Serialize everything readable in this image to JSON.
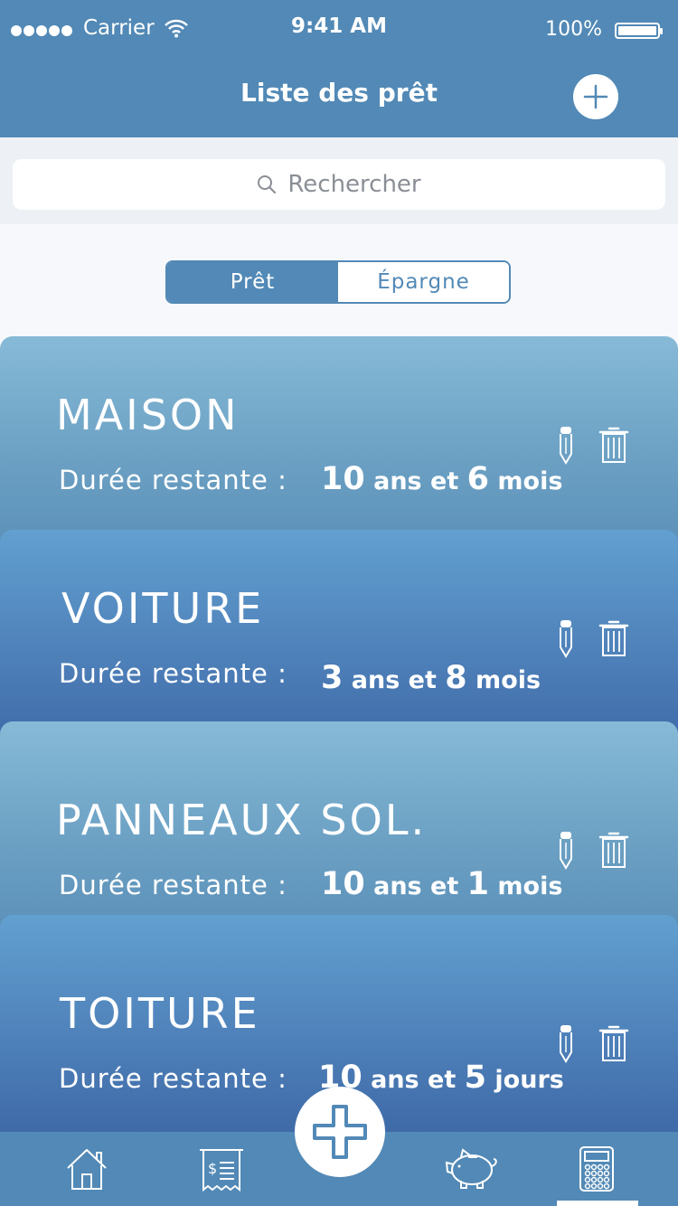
{
  "status": {
    "carrier": "Carrier",
    "time": "9:41 AM",
    "battery": "100%"
  },
  "nav": {
    "title": "Liste des prêt",
    "add_icon": "plus-circle-icon"
  },
  "search": {
    "placeholder": "Rechercher"
  },
  "segments": {
    "loan": "Prêt",
    "savings": "Épargne",
    "selected": "Prêt"
  },
  "cards": [
    {
      "title": "MAISON",
      "duration_label": "Durée restante :",
      "num1": "10",
      "unit1": " ans et ",
      "num2": "6",
      "unit2": " mois"
    },
    {
      "title": "VOITURE",
      "duration_label": "Durée restante :",
      "num1": "3",
      "unit1": " ans et ",
      "num2": "8",
      "unit2": " mois"
    },
    {
      "title": "PANNEAUX SOL.",
      "duration_label": "Durée restante :",
      "num1": "10",
      "unit1": " ans et ",
      "num2": "1",
      "unit2": " mois"
    },
    {
      "title": "TOITURE",
      "duration_label": "Durée restante :",
      "num1": "10",
      "unit1": " ans et ",
      "num2": "5",
      "unit2": " jours"
    }
  ],
  "tabs": [
    "home-icon",
    "receipt-icon",
    "add-icon",
    "piggy-bank-icon",
    "calculator-icon"
  ],
  "colors": {
    "primary": "#5289b6",
    "card_light": "#7fb3d3",
    "card_dark": "#4f82ba"
  }
}
